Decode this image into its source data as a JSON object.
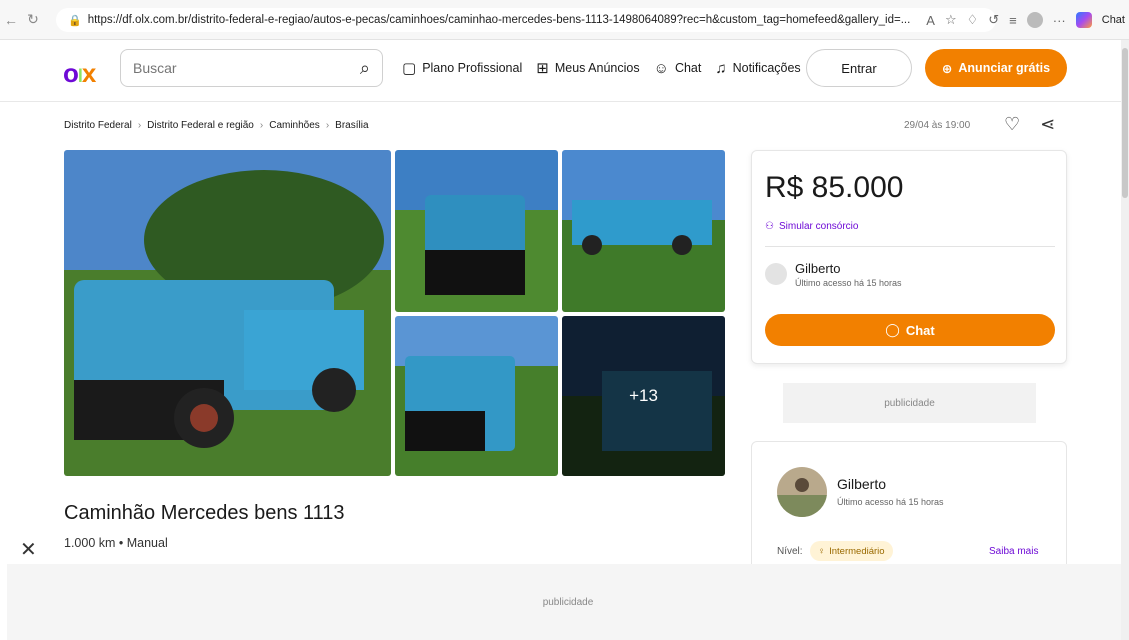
{
  "browser": {
    "url": "https://df.olx.com.br/distrito-federal-e-regiao/autos-e-pecas/caminhoes/caminhao-mercedes-bens-1113-1498064089?rec=h&custom_tag=homefeed&gallery_id=...",
    "copilot_label": "Chat"
  },
  "header": {
    "search_placeholder": "Buscar",
    "links": [
      "Plano Profissional",
      "Meus Anúncios",
      "Chat",
      "Notificações"
    ],
    "entrar": "Entrar",
    "anunciar": "Anunciar grátis"
  },
  "breadcrumb": [
    "Distrito Federal",
    "Distrito Federal e região",
    "Caminhões",
    "Brasília"
  ],
  "posted": "29/04 às 19:00",
  "gallery": {
    "more": "+13"
  },
  "listing": {
    "title": "Caminhão Mercedes bens 1113",
    "specs": "1.000 km • Manual"
  },
  "price_card": {
    "price": "R$ 85.000",
    "simular": "Simular consórcio",
    "seller_name": "Gilberto",
    "seller_last": "Último acesso há 15 horas",
    "chat": "Chat"
  },
  "ad_label": "publicidade",
  "seller_card": {
    "name": "Gilberto",
    "last": "Último acesso há 15 horas",
    "nivel_label": "Nível:",
    "nivel": "Intermediário",
    "saiba": "Saiba mais"
  },
  "bottom_ad": "publicidade",
  "colors": {
    "accent": "#f28000",
    "brand_purple": "#6e0ad6"
  }
}
